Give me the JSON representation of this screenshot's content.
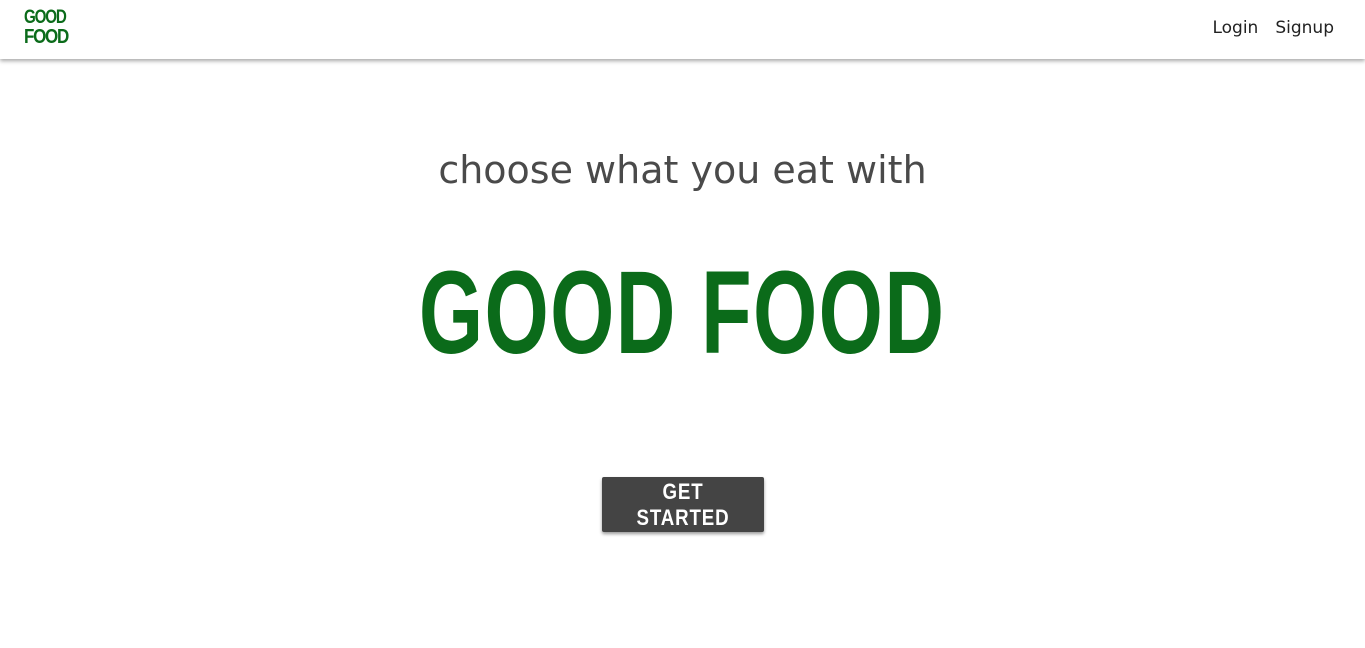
{
  "navbar": {
    "logo": {
      "line1": "GOOD",
      "line2": "FOOD"
    },
    "links": [
      {
        "label": "Login"
      },
      {
        "label": "Signup"
      }
    ]
  },
  "hero": {
    "subtitle": "choose what you eat with",
    "title": "GOOD FOOD",
    "cta_label": "GET STARTED"
  },
  "colors": {
    "brand_green": "#0b6b1a",
    "button_bg": "#444444",
    "subtitle_text": "#4a4a4a"
  }
}
